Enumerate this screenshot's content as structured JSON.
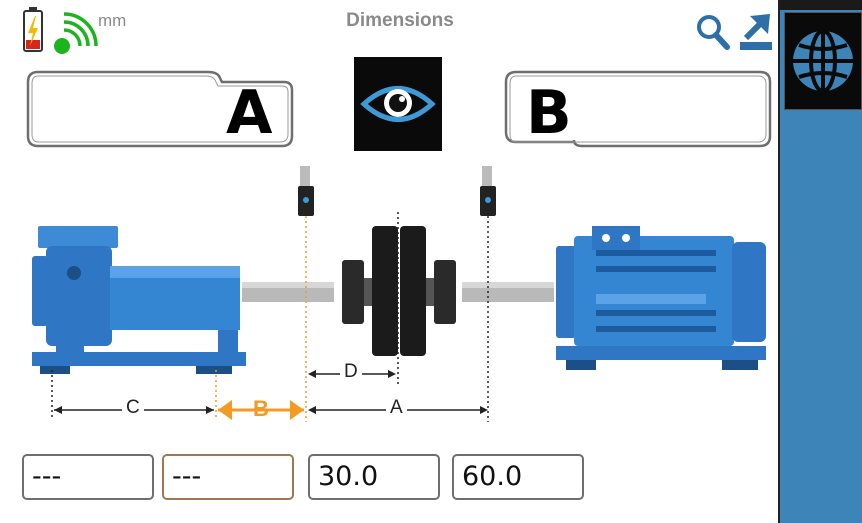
{
  "header": {
    "title": "Dimensions",
    "unit": "mm",
    "battery_icon": "battery-charging-icon",
    "signal_icon": "wireless-signal-icon",
    "search_icon": "search-icon",
    "export_icon": "export-icon"
  },
  "machines": {
    "left_label": "A",
    "right_label": "B",
    "view_button_icon": "eye-icon"
  },
  "dimensions": {
    "c_label": "C",
    "b_label": "B",
    "a_label": "A",
    "d_label": "D"
  },
  "fields": [
    {
      "name": "dimension-c",
      "value": "---"
    },
    {
      "name": "dimension-b",
      "value": "---"
    },
    {
      "name": "dimension-d",
      "value": "30.0"
    },
    {
      "name": "dimension-a",
      "value": "60.0"
    }
  ],
  "sidebar": {
    "globe_icon": "globe-icon"
  },
  "colors": {
    "accent_blue": "#3d84b8",
    "machine_blue": "#2f77c4",
    "highlight_orange": "#f39a25",
    "title_gray": "#8a8a8a"
  }
}
